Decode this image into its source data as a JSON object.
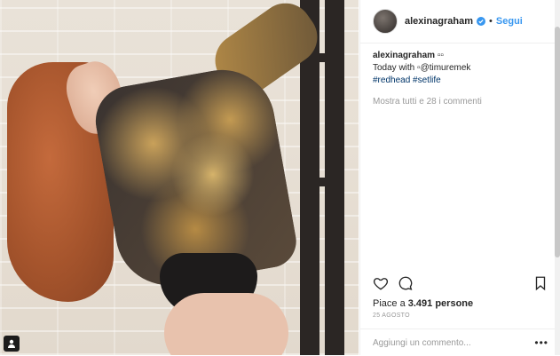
{
  "post": {
    "username": "alexinagraham",
    "follow_label": "Segui",
    "separator": "•"
  },
  "caption": {
    "username": "alexinagraham",
    "line1_suffix": " ▫▫",
    "line2_text": "Today with ▫@timuremek",
    "hashtag1": "#redhead",
    "hashtag2": "#setlife",
    "view_comments": "Mostra tutti e 28 i commenti"
  },
  "engagement": {
    "likes_prefix": "Piace a ",
    "likes_count": "3.491 persone",
    "date": "25 AGOSTO"
  },
  "comment_input": {
    "placeholder": "Aggiungi un commento...",
    "more_label": "•••"
  },
  "icons": {
    "verified": "verified-badge-icon",
    "like": "heart-icon",
    "comment": "comment-bubble-icon",
    "save": "bookmark-icon",
    "tag": "user-tag-icon"
  },
  "colors": {
    "link": "#3897f0",
    "text": "#262626",
    "muted": "#999999"
  }
}
